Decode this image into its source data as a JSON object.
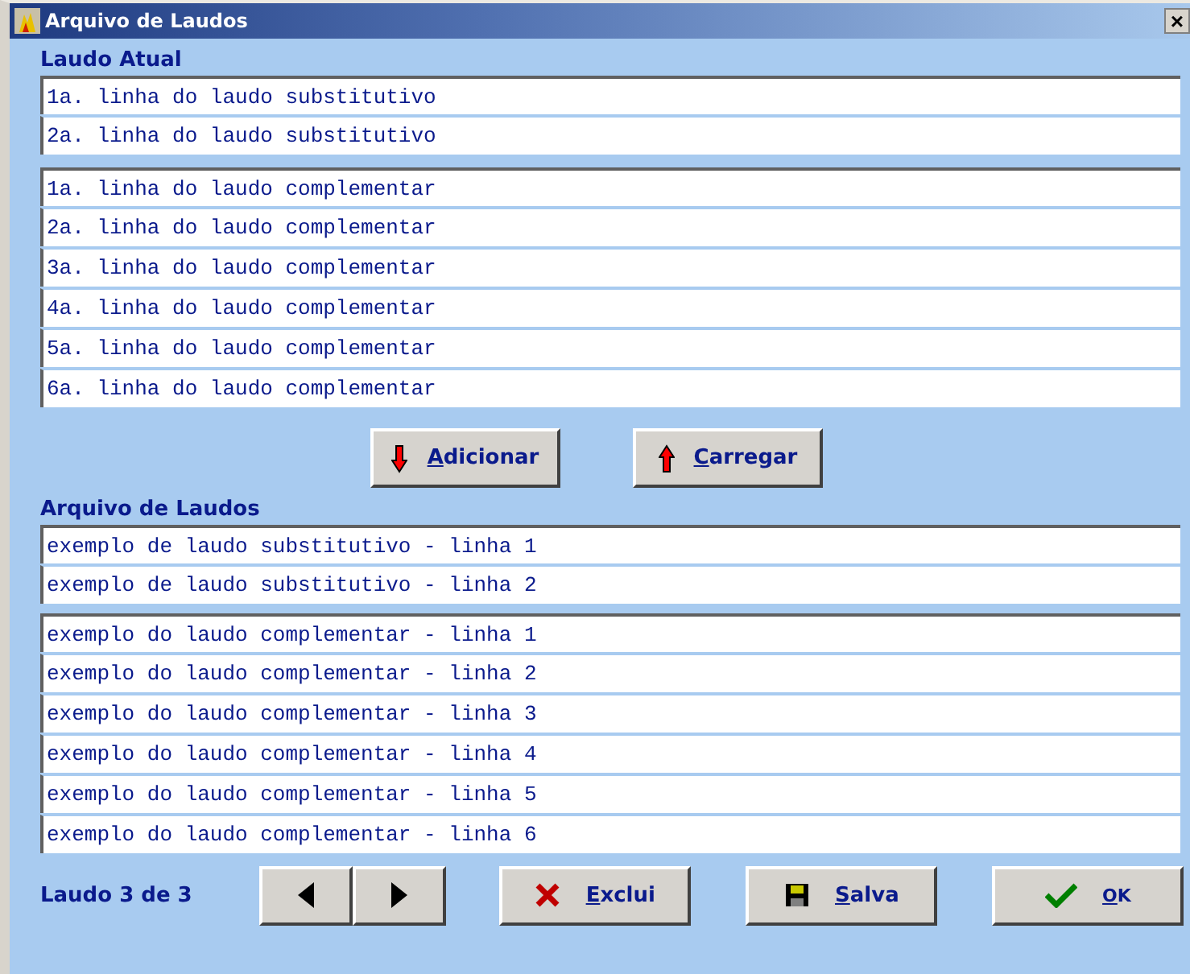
{
  "window": {
    "title": "Arquivo de Laudos",
    "close": "×"
  },
  "current": {
    "heading": "Laudo Atual",
    "groups": [
      [
        "1a. linha do laudo substitutivo",
        "2a. linha do laudo substitutivo"
      ],
      [
        "1a. linha do laudo complementar",
        "2a. linha do laudo complementar",
        "3a. linha do laudo complementar",
        "4a. linha do laudo complementar",
        "5a. linha do laudo complementar",
        "6a. linha do laudo complementar"
      ]
    ]
  },
  "actions": [
    {
      "kind": "down",
      "accel": "A",
      "rest": "dicionar"
    },
    {
      "kind": "up",
      "accel": "C",
      "rest": "arregar"
    }
  ],
  "archive": {
    "heading": "Arquivo de Laudos",
    "groups": [
      [
        "exemplo de laudo substitutivo - linha 1",
        "exemplo de laudo substitutivo - linha 2"
      ],
      [
        "exemplo do laudo complementar - linha 1",
        "exemplo do laudo complementar - linha 2",
        "exemplo do laudo complementar - linha 3",
        "exemplo do laudo complementar - linha 4",
        "exemplo do laudo complementar - linha 5",
        "exemplo do laudo complementar - linha 6"
      ]
    ]
  },
  "footer": {
    "counter": "Laudo 3 de 3",
    "buttons": [
      {
        "kind": "delete",
        "accel": "E",
        "rest": "xclui"
      },
      {
        "kind": "save",
        "accel": "S",
        "rest": "alva"
      },
      {
        "kind": "ok",
        "accel": "O",
        "rest": "K"
      }
    ]
  }
}
